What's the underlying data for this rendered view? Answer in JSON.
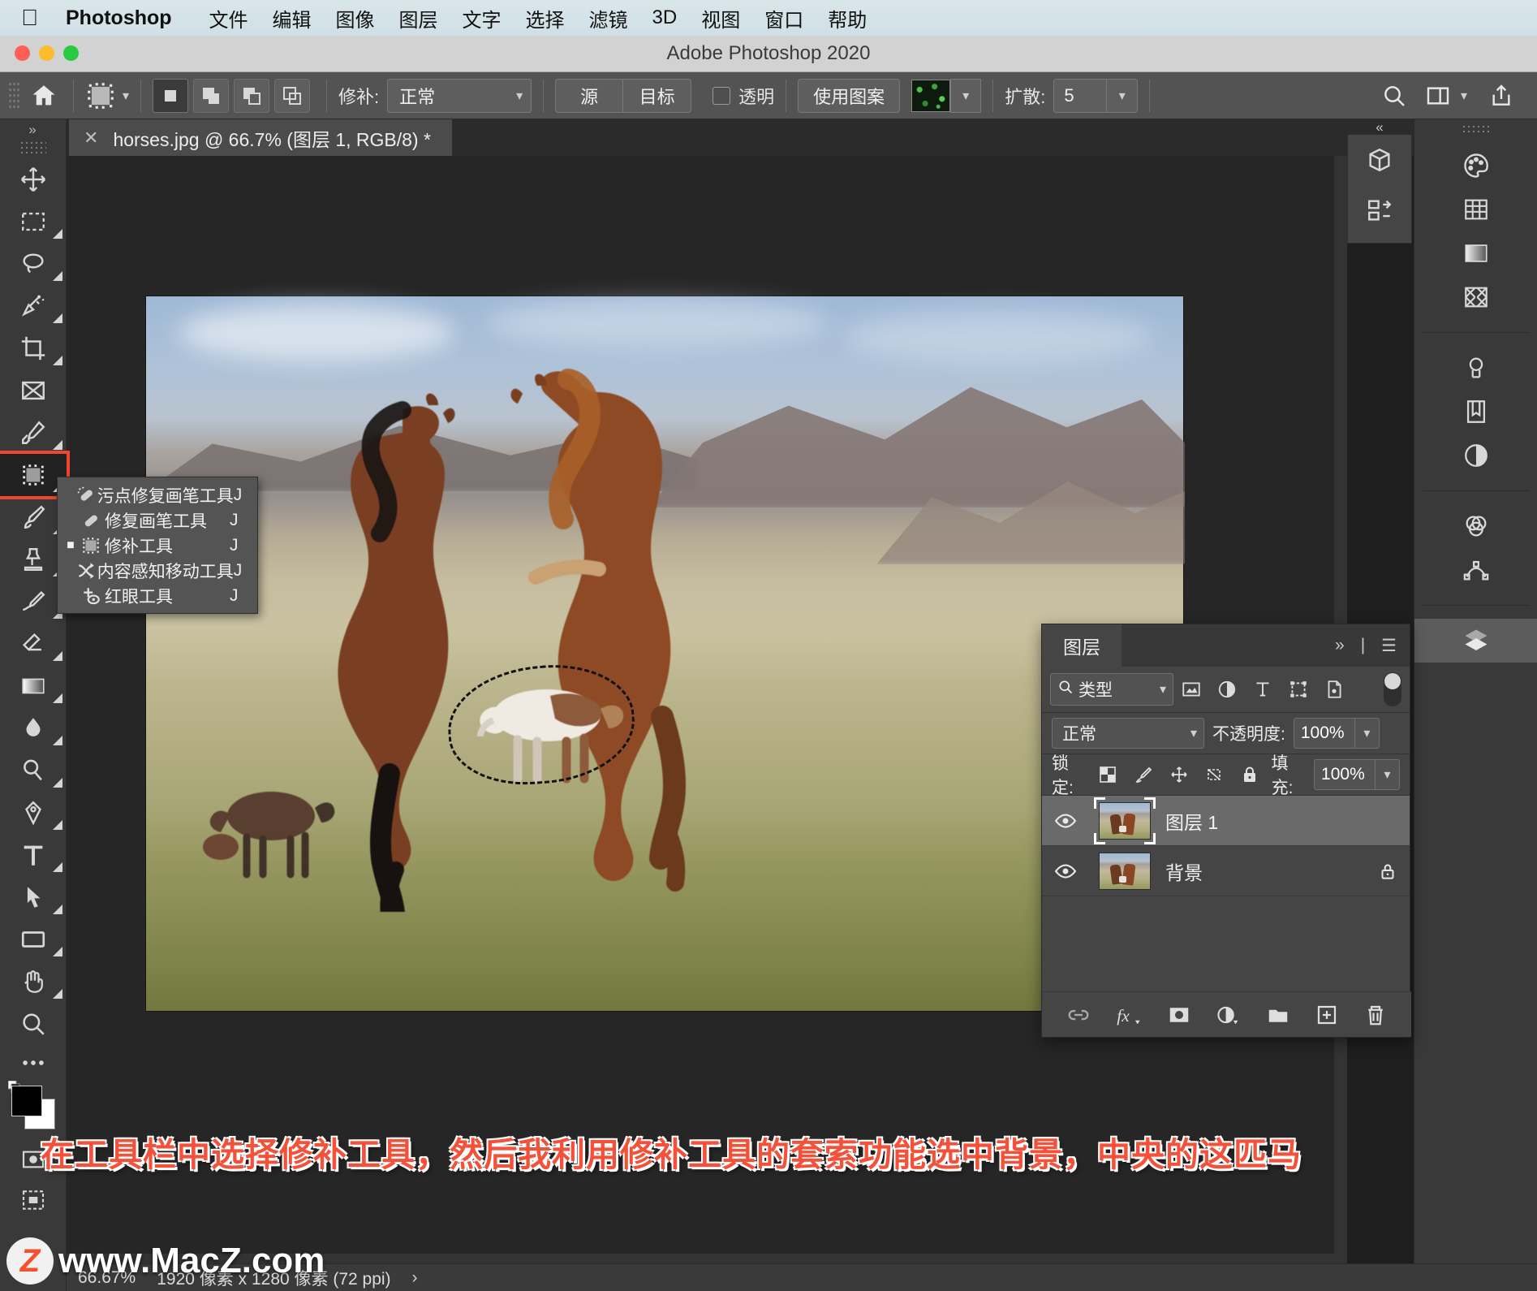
{
  "mac_menu": {
    "apple_icon": "apple-icon",
    "brand": "Photoshop",
    "items": [
      "文件",
      "编辑",
      "图像",
      "图层",
      "文字",
      "选择",
      "滤镜",
      "3D",
      "视图",
      "窗口",
      "帮助"
    ]
  },
  "window": {
    "title": "Adobe Photoshop 2020"
  },
  "options_bar": {
    "home_icon": "home-icon",
    "tool_preset_icon": "patch-tool-icon",
    "tool_preset_caret": "chevron-down-icon",
    "selection_modes": [
      "new-selection-icon",
      "add-selection-icon",
      "subtract-selection-icon",
      "intersect-selection-icon"
    ],
    "patch_label": "修补:",
    "patch_value": "正常",
    "source_label": "源",
    "destination_label": "目标",
    "transparent_label": "透明",
    "use_pattern_label": "使用图案",
    "pattern_swatch": "pattern-swatch",
    "pattern_caret": "chevron-down-icon",
    "diffusion_label": "扩散:",
    "diffusion_value": "5",
    "search_icon": "search-icon",
    "workspace_icon": "workspace-icon",
    "workspace_caret": "chevron-down-icon",
    "share_icon": "share-icon"
  },
  "document_tab": {
    "close_icon": "close-icon",
    "title": "horses.jpg @ 66.7% (图层 1, RGB/8) *"
  },
  "toolbar": {
    "collapse_icon": "expand-panel-icon",
    "tools": [
      {
        "name": "move-tool",
        "icon": "move-icon",
        "has_flyout": false
      },
      {
        "name": "rectangular-marquee-tool",
        "icon": "marquee-icon",
        "has_flyout": true
      },
      {
        "name": "lasso-tool",
        "icon": "lasso-icon",
        "has_flyout": true
      },
      {
        "name": "object-selection-tool",
        "icon": "magic-wand-icon",
        "has_flyout": true
      },
      {
        "name": "crop-tool",
        "icon": "crop-icon",
        "has_flyout": true
      },
      {
        "name": "frame-tool",
        "icon": "frame-icon",
        "has_flyout": false
      },
      {
        "name": "eyedropper-tool",
        "icon": "eyedropper-icon",
        "has_flyout": true
      },
      {
        "name": "patch-tool",
        "icon": "patch-icon",
        "has_flyout": true,
        "selected": true
      },
      {
        "name": "brush-tool",
        "icon": "brush-icon",
        "has_flyout": true
      },
      {
        "name": "clone-stamp-tool",
        "icon": "stamp-icon",
        "has_flyout": true
      },
      {
        "name": "history-brush-tool",
        "icon": "history-brush-icon",
        "has_flyout": true
      },
      {
        "name": "eraser-tool",
        "icon": "eraser-icon",
        "has_flyout": true
      },
      {
        "name": "gradient-tool",
        "icon": "gradient-icon",
        "has_flyout": true
      },
      {
        "name": "blur-tool",
        "icon": "blur-drop-icon",
        "has_flyout": true
      },
      {
        "name": "dodge-tool",
        "icon": "dodge-icon",
        "has_flyout": true
      },
      {
        "name": "pen-tool",
        "icon": "pen-icon",
        "has_flyout": true
      },
      {
        "name": "type-tool",
        "icon": "text-T-icon",
        "has_flyout": true
      },
      {
        "name": "path-selection-tool",
        "icon": "path-arrow-icon",
        "has_flyout": true
      },
      {
        "name": "rectangle-tool",
        "icon": "rectangle-icon",
        "has_flyout": true
      },
      {
        "name": "hand-tool",
        "icon": "hand-icon",
        "has_flyout": true
      },
      {
        "name": "zoom-tool",
        "icon": "zoom-magnifier-icon",
        "has_flyout": false
      },
      {
        "name": "edit-toolbar",
        "icon": "ellipsis-icon",
        "has_flyout": false
      }
    ],
    "foreground_color": "#000000",
    "background_color": "#ffffff",
    "quick_mask_icon": "quick-mask-icon",
    "screen_mode_icon": "screen-mode-icon"
  },
  "flyout_menu": {
    "items": [
      {
        "icon": "spot-healing-brush-icon",
        "label": "污点修复画笔工具",
        "shortcut": "J",
        "checked": false
      },
      {
        "icon": "healing-brush-icon",
        "label": "修复画笔工具",
        "shortcut": "J",
        "checked": false
      },
      {
        "icon": "patch-icon",
        "label": "修补工具",
        "shortcut": "J",
        "checked": true
      },
      {
        "icon": "content-aware-move-icon",
        "label": "内容感知移动工具",
        "shortcut": "J",
        "checked": false
      },
      {
        "icon": "red-eye-icon",
        "label": "红眼工具",
        "shortcut": "J",
        "checked": false
      }
    ]
  },
  "canvas": {
    "image_name": "horses-photo",
    "selection_name": "lasso-selection-marching-ants"
  },
  "right_dock": {
    "collapse_icon": "collapse-panels-icon",
    "top_icons": [
      "3d-panel-icon",
      "timeline-panel-icon"
    ],
    "icons": [
      {
        "name": "color-panel-icon",
        "group": 1
      },
      {
        "name": "swatches-panel-icon",
        "group": 1
      },
      {
        "name": "gradients-panel-icon",
        "group": 1
      },
      {
        "name": "patterns-panel-icon",
        "group": 1
      },
      {
        "name": "adjustments-panel-icon",
        "group": 2
      },
      {
        "name": "libraries-panel-icon",
        "group": 2
      },
      {
        "name": "properties-panel-icon",
        "group": 2
      },
      {
        "name": "channels-panel-icon",
        "group": 3
      },
      {
        "name": "paths-panel-icon",
        "group": 3
      },
      {
        "name": "layers-panel-icon",
        "group": 4,
        "active": true
      }
    ]
  },
  "layers_panel": {
    "tab_label": "图层",
    "expand_icon": "double-chevron-right-icon",
    "menu_icon": "panel-menu-icon",
    "filter": {
      "search_icon": "search-icon",
      "value": "类型",
      "caret": "chevron-down-icon",
      "type_filters": [
        "pixel-filter-icon",
        "adjustment-filter-icon",
        "type-filter-icon",
        "shape-filter-icon",
        "smart-object-filter-icon"
      ],
      "toggle": "filter-enable-toggle"
    },
    "blend_mode": "正常",
    "opacity_label": "不透明度:",
    "opacity_value": "100%",
    "lock_label": "锁定:",
    "lock_icons": [
      "lock-transparent-pixels-icon",
      "lock-image-pixels-icon",
      "lock-position-icon",
      "lock-artboard-nesting-icon",
      "lock-all-icon"
    ],
    "fill_label": "填充:",
    "fill_value": "100%",
    "layers": [
      {
        "name": "图层 1",
        "visible": true,
        "locked": false,
        "selected": true,
        "thumb": "horses-thumb"
      },
      {
        "name": "背景",
        "visible": true,
        "locked": true,
        "selected": false,
        "thumb": "horses-thumb"
      }
    ],
    "footer_icons": [
      "link-layers-icon",
      "add-fx-icon",
      "add-layer-mask-icon",
      "new-adjustment-layer-icon",
      "new-group-icon",
      "new-layer-icon",
      "delete-layer-icon"
    ]
  },
  "annotation": {
    "text": "在工具栏中选择修补工具，然后我利用修补工具的套索功能选中背景，中央的这匹马",
    "color": "#f4513a"
  },
  "status_bar": {
    "zoom": "66.67%",
    "dimensions": "1920 像素 x 1280 像素 (72 ppi)",
    "arrow_icon": "chevron-right-icon"
  },
  "watermark": {
    "badge": "Z",
    "text": "www.MacZ.com"
  }
}
